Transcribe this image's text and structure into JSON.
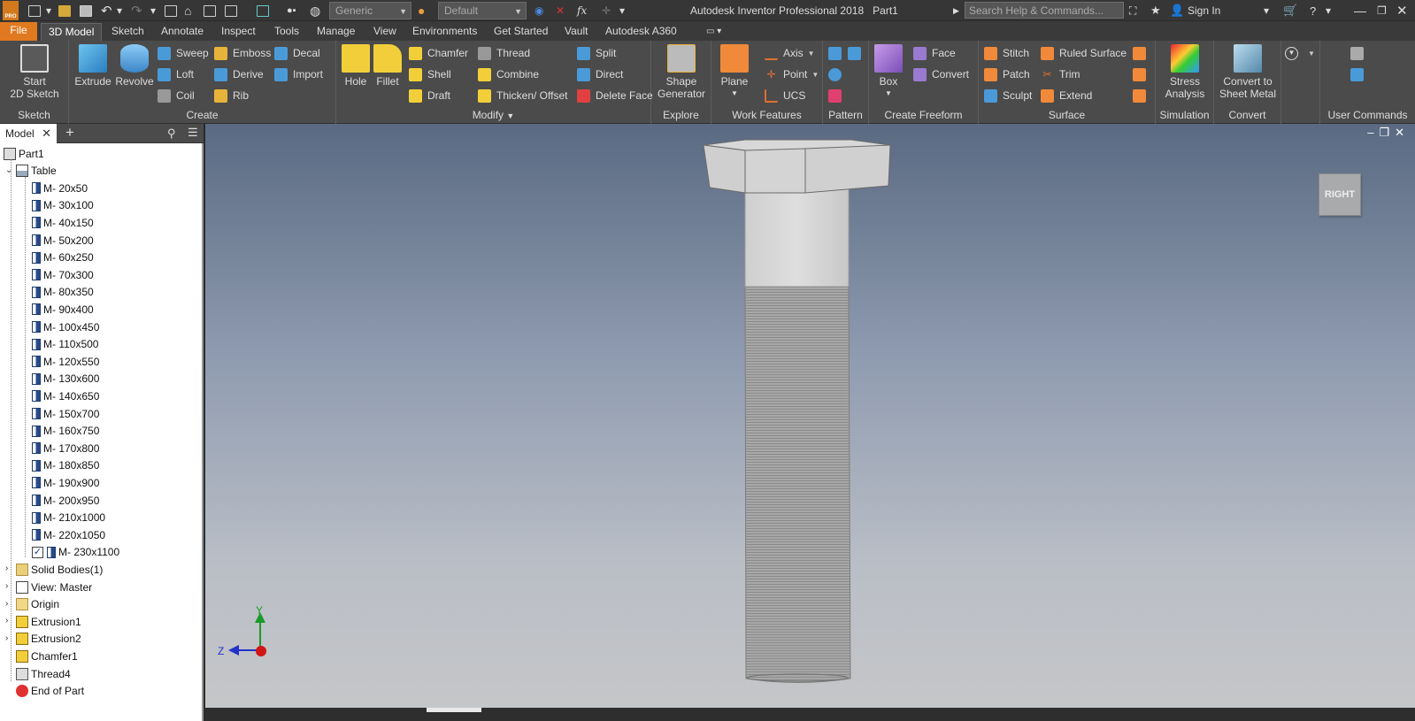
{
  "app": {
    "title": "Autodesk Inventor Professional 2018",
    "document": "Part1",
    "logo_text": "I",
    "logo_sub": "PRO"
  },
  "quick_access": {
    "material": "Generic",
    "appearance": "Default"
  },
  "search": {
    "placeholder": "Search Help & Commands..."
  },
  "sign_in": "Sign In",
  "tabs": [
    "File",
    "3D Model",
    "Sketch",
    "Annotate",
    "Inspect",
    "Tools",
    "Manage",
    "View",
    "Environments",
    "Get Started",
    "Vault",
    "Autodesk A360"
  ],
  "active_tab": "3D Model",
  "ribbon": {
    "sketch": {
      "label": "Sketch",
      "start_sketch": "Start\n2D Sketch"
    },
    "create": {
      "label": "Create",
      "extrude": "Extrude",
      "revolve": "Revolve",
      "sweep": "Sweep",
      "loft": "Loft",
      "coil": "Coil",
      "emboss": "Emboss",
      "derive": "Derive",
      "rib": "Rib",
      "decal": "Decal",
      "import": "Import"
    },
    "modify": {
      "label": "Modify",
      "hole": "Hole",
      "fillet": "Fillet",
      "chamfer": "Chamfer",
      "shell": "Shell",
      "draft": "Draft",
      "thread": "Thread",
      "combine": "Combine",
      "thicken": "Thicken/ Offset",
      "split": "Split",
      "direct": "Direct",
      "delete_face": "Delete Face"
    },
    "explore": {
      "label": "Explore",
      "shape_generator": "Shape\nGenerator"
    },
    "work_features": {
      "label": "Work Features",
      "plane": "Plane",
      "axis": "Axis",
      "point": "Point",
      "ucs": "UCS"
    },
    "pattern": {
      "label": "Pattern"
    },
    "freeform": {
      "label": "Create Freeform",
      "box": "Box",
      "face": "Face",
      "convert": "Convert"
    },
    "surface": {
      "label": "Surface",
      "stitch": "Stitch",
      "patch": "Patch",
      "sculpt": "Sculpt",
      "ruled_surface": "Ruled Surface",
      "trim": "Trim",
      "extend": "Extend"
    },
    "simulation": {
      "label": "Simulation",
      "stress": "Stress\nAnalysis"
    },
    "convert": {
      "label": "Convert",
      "sheet_metal": "Convert to\nSheet Metal"
    },
    "user_commands": {
      "label": "User Commands"
    }
  },
  "browser": {
    "tab": "Model",
    "root": "Part1",
    "table": "Table",
    "configs": [
      "M- 20x50",
      "M- 30x100",
      "M- 40x150",
      "M- 50x200",
      "M- 60x250",
      "M- 70x300",
      "M- 80x350",
      "M- 90x400",
      "M- 100x450",
      "M- 110x500",
      "M- 120x550",
      "M- 130x600",
      "M- 140x650",
      "M- 150x700",
      "M- 160x750",
      "M- 170x800",
      "M- 180x850",
      "M- 190x900",
      "M- 200x950",
      "M- 210x1000",
      "M- 220x1050",
      "M- 230x1100"
    ],
    "active_config": "M- 230x1100",
    "items": [
      "Solid Bodies(1)",
      "View: Master",
      "Origin",
      "Extrusion1",
      "Extrusion2",
      "Chamfer1",
      "Thread4",
      "End of Part"
    ]
  },
  "viewport": {
    "viewcube_face": "RIGHT",
    "axis_y": "Y",
    "axis_z": "Z"
  }
}
